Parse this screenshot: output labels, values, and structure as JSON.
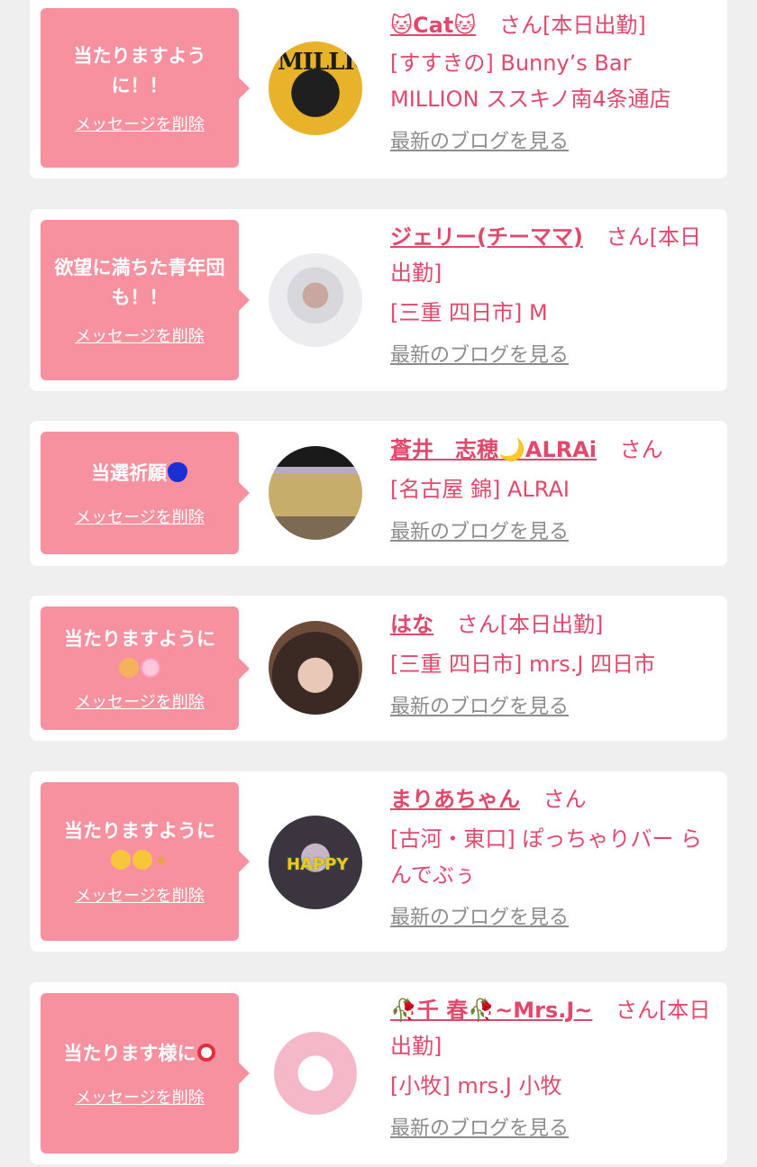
{
  "items": [
    {
      "message": "当たりますように！！",
      "delete_label": "メッセージを削除",
      "name": "🐱Cat🐱",
      "suffix": "さん[本日出勤]",
      "shop": "[すすきの] Bunny’s Bar MILLION ススキノ南4条通店",
      "blog_label": "最新のブログを見る",
      "avatar_text": "MILLION"
    },
    {
      "message": "欲望に満ちた青年団も！！",
      "delete_label": "メッセージを削除",
      "name": "ジェリー(チーママ)",
      "suffix": "さん[本日出勤]",
      "shop": "[三重 四日市] M",
      "blog_label": "最新のブログを見る"
    },
    {
      "message": "当選祈願",
      "message_emoji": "blue-heart",
      "delete_label": "メッセージを削除",
      "name": "蒼井　志穂🌙ALRAi",
      "suffix": "さん",
      "shop": "[名古屋 錦] ALRAI",
      "blog_label": "最新のブログを見る"
    },
    {
      "message": "当たりますように",
      "message_emoji": "pray pink-heart",
      "delete_label": "メッセージを削除",
      "name": "はな",
      "suffix": "さん[本日出勤]",
      "shop": "[三重 四日市] mrs.J 四日市",
      "blog_label": "最新のブログを見る"
    },
    {
      "message": "当たりますように",
      "message_emoji": "smiling-hearts star-eyes sparkles",
      "delete_label": "メッセージを削除",
      "name": "まりあちゃん",
      "suffix": "さん",
      "shop": "[古河・東口] ぽっちゃりバー らんでぶぅ",
      "blog_label": "最新のブログを見る",
      "avatar_text": "HAPPY"
    },
    {
      "message": "当たります様に",
      "message_emoji": "target",
      "delete_label": "メッセージを削除",
      "name": "🥀千 春🥀~Mrs.J~",
      "suffix": "さん[本日出勤]",
      "shop": "[小牧] mrs.J 小牧",
      "blog_label": "最新のブログを見る"
    }
  ],
  "colors": {
    "background": "#efefef",
    "bubble": "#f7909f",
    "link": "#e0496c",
    "blog_link": "#8c8c8c"
  }
}
